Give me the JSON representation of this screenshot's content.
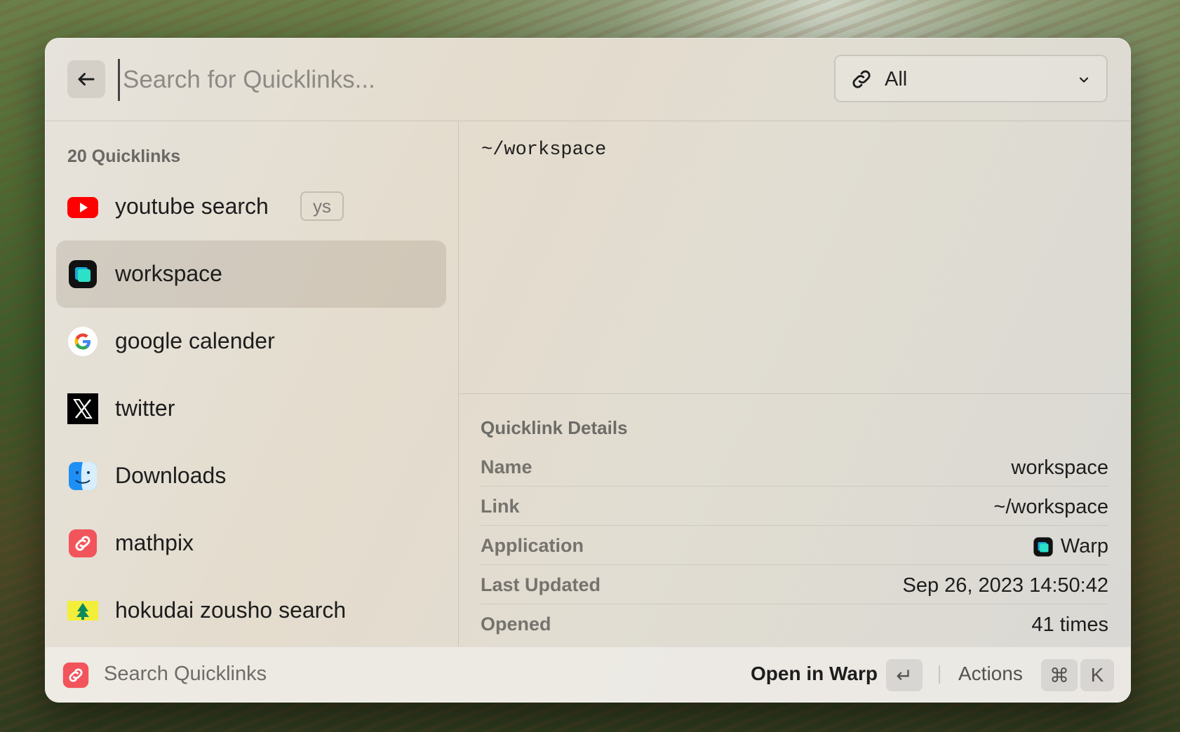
{
  "search": {
    "placeholder": "Search for Quicklinks...",
    "filter_label": "All"
  },
  "list": {
    "section_title": "20 Quicklinks",
    "items": [
      {
        "label": "youtube search",
        "alias": "ys",
        "icon": "youtube-icon"
      },
      {
        "label": "workspace",
        "icon": "warp-icon",
        "selected": true
      },
      {
        "label": "google calender",
        "icon": "google-icon"
      },
      {
        "label": "twitter",
        "icon": "x-icon"
      },
      {
        "label": "Downloads",
        "icon": "finder-icon"
      },
      {
        "label": "mathpix",
        "icon": "link-icon"
      },
      {
        "label": "hokudai zousho search",
        "icon": "hokudai-icon"
      }
    ]
  },
  "preview": {
    "text": "~/workspace"
  },
  "details": {
    "title": "Quicklink Details",
    "rows": [
      {
        "key": "Name",
        "value": "workspace"
      },
      {
        "key": "Link",
        "value": "~/workspace"
      },
      {
        "key": "Application",
        "value": "Warp",
        "icon": "warp-icon"
      },
      {
        "key": "Last Updated",
        "value": "Sep 26, 2023 14:50:42"
      },
      {
        "key": "Opened",
        "value": "41 times"
      }
    ]
  },
  "footer": {
    "app_name": "Search Quicklinks",
    "primary_action": "Open in Warp",
    "enter_key": "↵",
    "actions_label": "Actions",
    "cmd_key": "⌘",
    "k_key": "K"
  },
  "colors": {
    "youtube_red": "#ff0000",
    "raycast_red": "#f2545b",
    "warp_teal": "#19c3c9"
  }
}
